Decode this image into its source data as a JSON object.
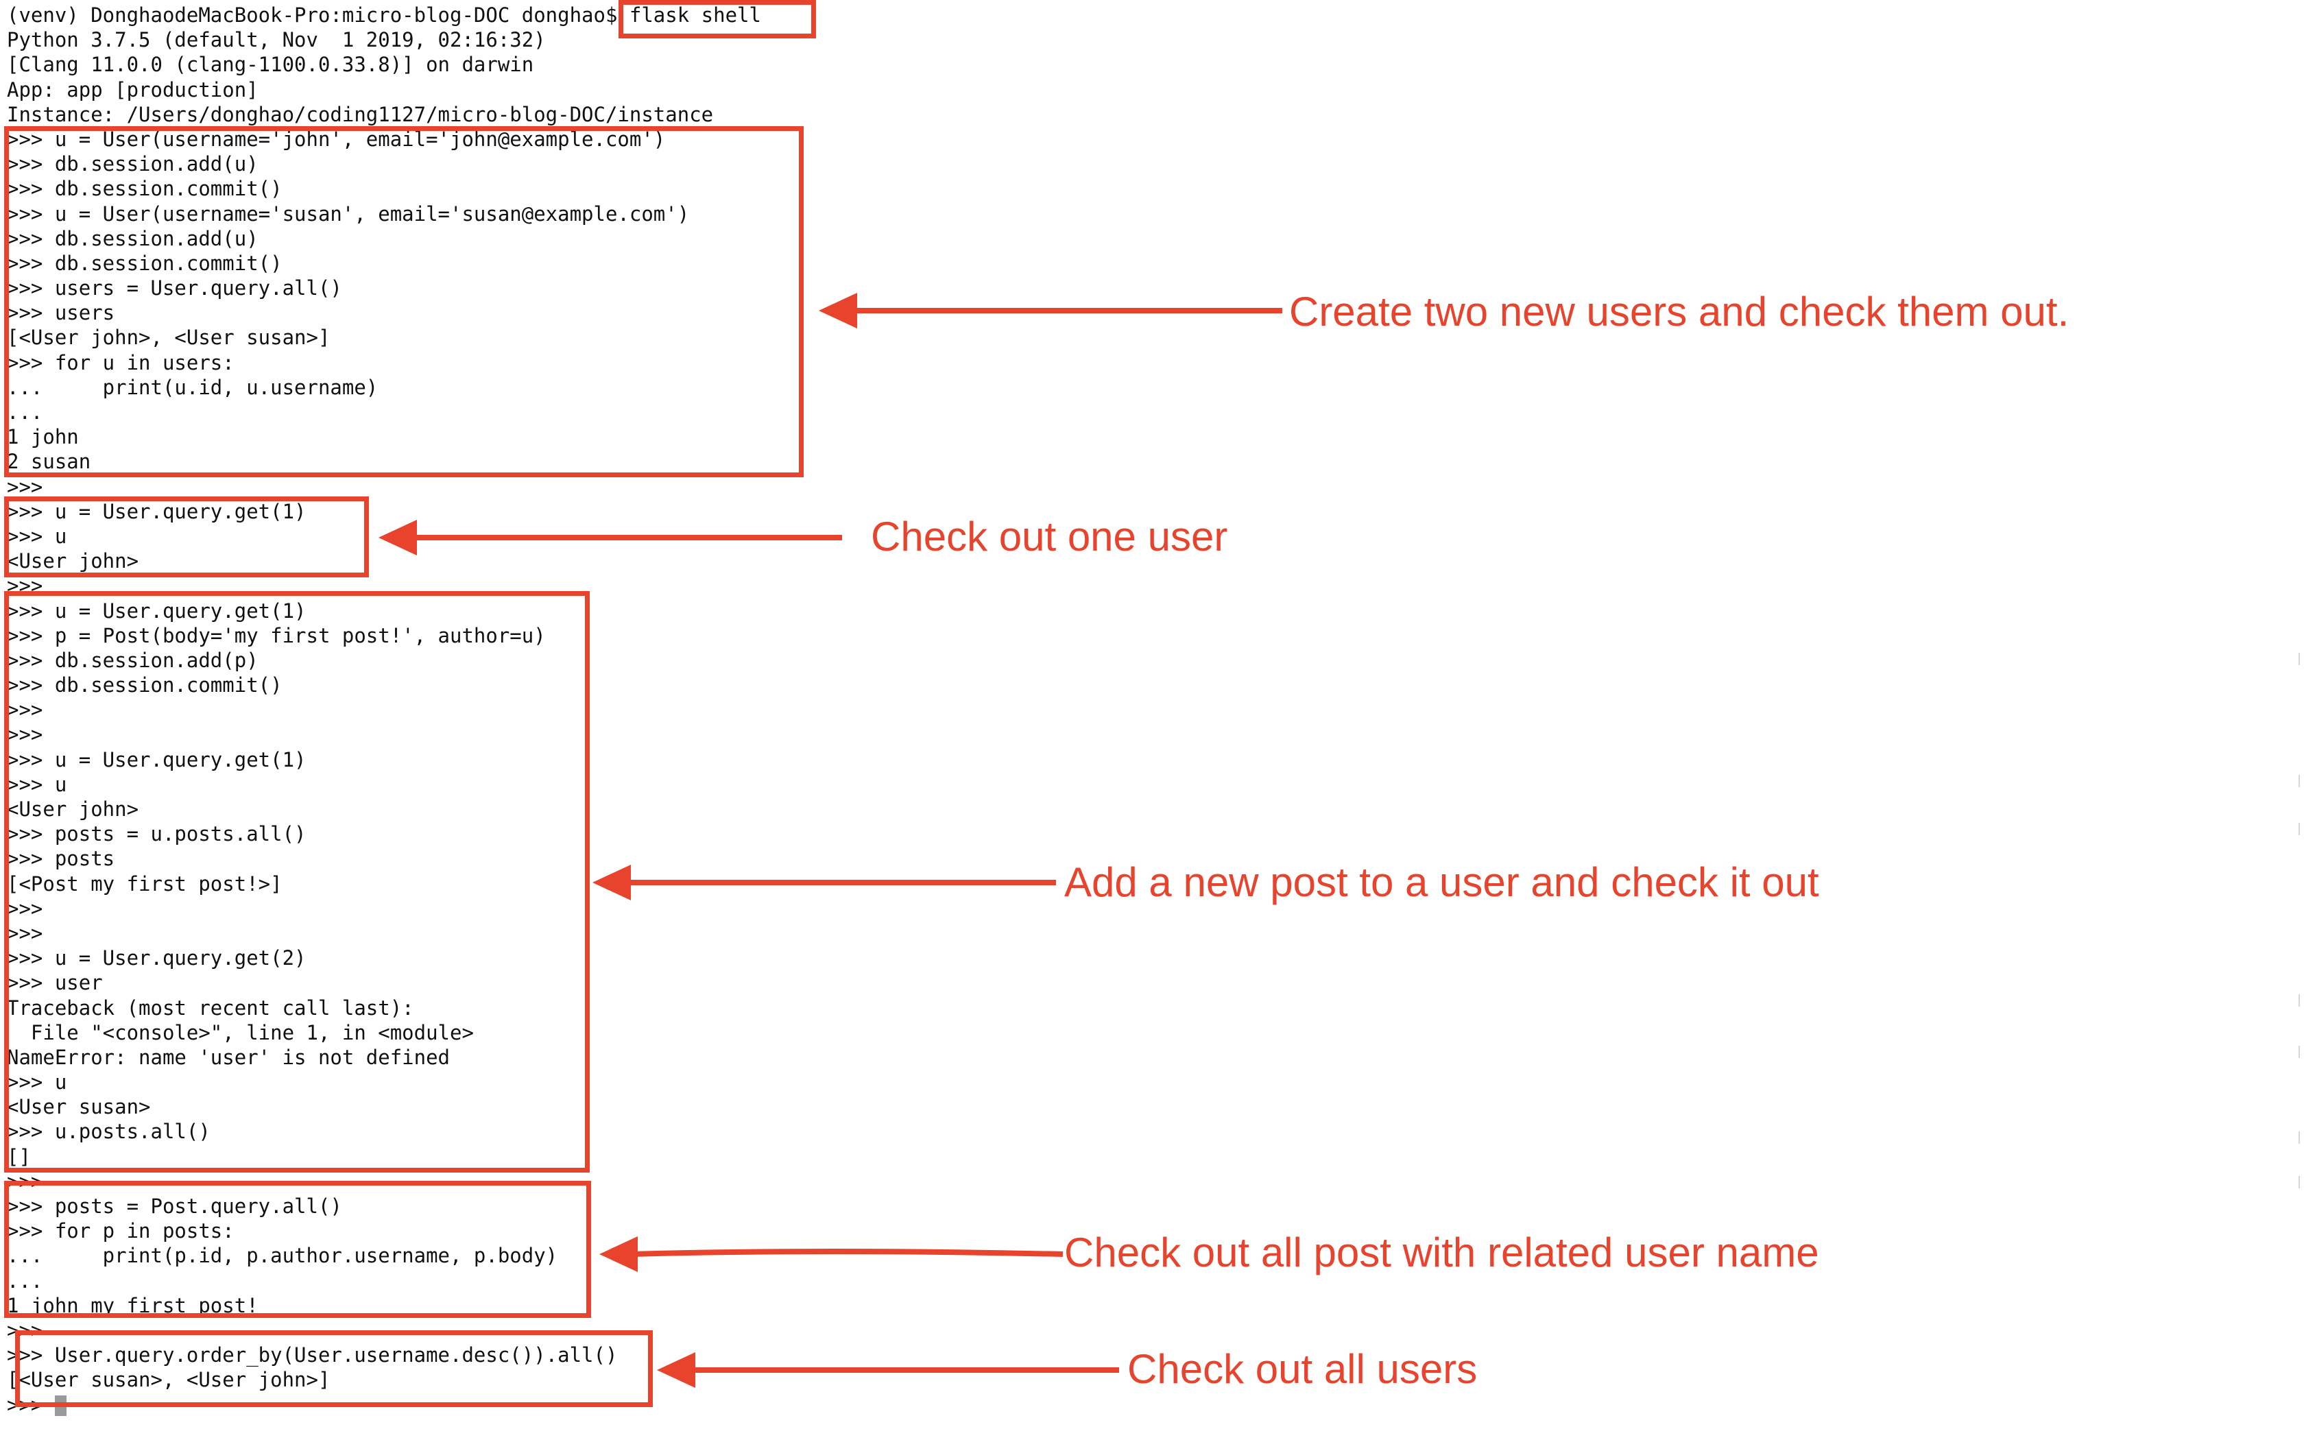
{
  "terminal": {
    "lines": [
      "(venv) DonghaodeMacBook-Pro:micro-blog-DOC donghao$ flask shell",
      "Python 3.7.5 (default, Nov  1 2019, 02:16:32)",
      "[Clang 11.0.0 (clang-1100.0.33.8)] on darwin",
      "App: app [production]",
      "Instance: /Users/donghao/coding1127/micro-blog-DOC/instance",
      ">>> u = User(username='john', email='john@example.com')",
      ">>> db.session.add(u)",
      ">>> db.session.commit()",
      ">>> u = User(username='susan', email='susan@example.com')",
      ">>> db.session.add(u)",
      ">>> db.session.commit()",
      ">>> users = User.query.all()",
      ">>> users",
      "[<User john>, <User susan>]",
      ">>> for u in users:",
      "...     print(u.id, u.username)",
      "...",
      "1 john",
      "2 susan",
      ">>>",
      ">>> u = User.query.get(1)",
      ">>> u",
      "<User john>",
      ">>>",
      ">>> u = User.query.get(1)",
      ">>> p = Post(body='my first post!', author=u)",
      ">>> db.session.add(p)",
      ">>> db.session.commit()",
      ">>>",
      ">>>",
      ">>> u = User.query.get(1)",
      ">>> u",
      "<User john>",
      ">>> posts = u.posts.all()",
      ">>> posts",
      "[<Post my first post!>]",
      ">>>",
      ">>>",
      ">>> u = User.query.get(2)",
      ">>> user",
      "Traceback (most recent call last):",
      "  File \"<console>\", line 1, in <module>",
      "NameError: name 'user' is not defined",
      ">>> u",
      "<User susan>",
      ">>> u.posts.all()",
      "[]",
      ">>>",
      ">>> posts = Post.query.all()",
      ">>> for p in posts:",
      "...     print(p.id, p.author.username, p.body)",
      "...",
      "1 john my first post!",
      ">>>",
      ">>> User.query.order_by(User.username.desc()).all()",
      "[<User susan>, <User john>]",
      ">>> "
    ]
  },
  "annotations": {
    "create_users": "Create two new users and check them out.",
    "one_user": "Check out one user",
    "add_post": "Add a new post to a user and check it out",
    "all_posts": "Check out all post with related user name",
    "all_users": "Check out all users"
  },
  "colors": {
    "annotation_red": "#e8432d",
    "terminal_text": "#111111",
    "background": "#ffffff"
  }
}
